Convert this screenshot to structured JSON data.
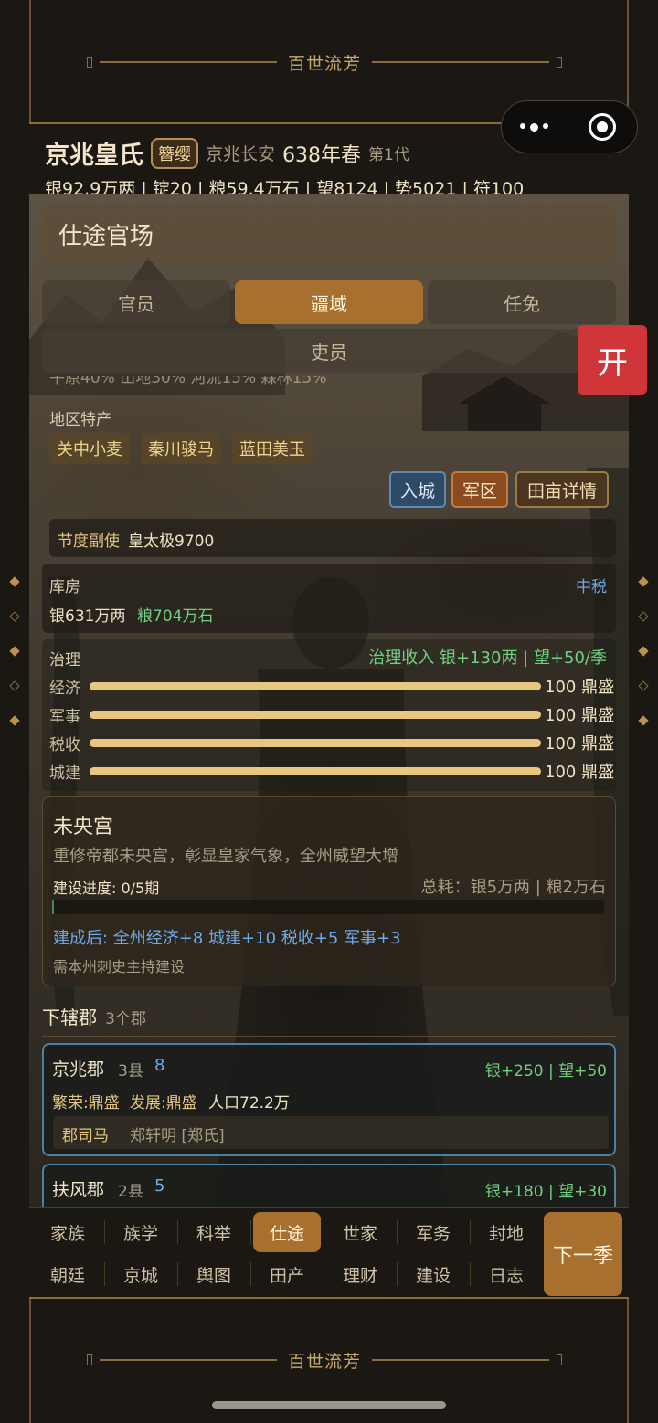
{
  "game_title": "百世流芳",
  "header": {
    "clan_name": "京兆皇氏",
    "title_badge": "簪缨",
    "location": "京兆长安",
    "date": "638年春",
    "generation": "第1代",
    "resources": "银92.9万两 | 锭20 | 粮59.4万石 | 望8124 | 势5021 | 符100"
  },
  "panel": {
    "title": "仕途官场",
    "tabs": [
      {
        "label": "官员",
        "active": false
      },
      {
        "label": "疆域",
        "active": true
      },
      {
        "label": "任免",
        "active": false
      },
      {
        "label": "吏员",
        "active": false
      }
    ]
  },
  "terrain_text": "平原40% 山地30% 河流15% 森林15%",
  "specialties": {
    "label": "地区特产",
    "items": [
      "关中小麦",
      "秦川骏马",
      "蓝田美玉"
    ]
  },
  "actions": [
    "入城",
    "军区",
    "田亩详情"
  ],
  "deputy": {
    "role": "节度副使",
    "name": "皇太极9700"
  },
  "treasury": {
    "label": "库房",
    "tax_level": "中税",
    "silver": "银631万两",
    "grain": "粮704万石"
  },
  "governance": {
    "label": "治理",
    "income": "治理收入 银+130两 | 望+50/季",
    "stats": [
      {
        "name": "经济",
        "value": 100,
        "max": 100,
        "display": "100 鼎盛"
      },
      {
        "name": "军事",
        "value": 100,
        "max": 100,
        "display": "100 鼎盛"
      },
      {
        "name": "税收",
        "value": 100,
        "max": 100,
        "display": "100 鼎盛"
      },
      {
        "name": "城建",
        "value": 100,
        "max": 100,
        "display": "100 鼎盛"
      }
    ]
  },
  "project": {
    "name": "未央宫",
    "desc": "重修帝都未央宫，彰显皇家气象，全州威望大增",
    "progress_label": "建设进度: 0/5期",
    "progress_value": 0,
    "progress_max": 5,
    "cost": "总耗：银5万两 | 粮2万石",
    "effect": "建成后: 全州经济+8 城建+10 税收+5 军事+3",
    "note": "需本州刺史主持建设"
  },
  "commanderies": {
    "label": "下辖郡",
    "count": "3个郡",
    "items": [
      {
        "name": "京兆郡",
        "counties": "3县",
        "level": "8",
        "yield": "银+250 | 望+50",
        "prosperity": "繁荣:鼎盛",
        "development": "发展:鼎盛",
        "population": "人口72.2万",
        "official_role": "郡司马",
        "official_name": "郑轩明 [郑氏]"
      },
      {
        "name": "扶风郡",
        "counties": "2县",
        "level": "5",
        "yield": "银+180 | 望+30"
      }
    ]
  },
  "nav": {
    "row1": [
      {
        "label": "家族",
        "active": false
      },
      {
        "label": "族学",
        "active": false
      },
      {
        "label": "科举",
        "active": false
      },
      {
        "label": "仕途",
        "active": true
      },
      {
        "label": "世家",
        "active": false
      },
      {
        "label": "军务",
        "active": false
      },
      {
        "label": "封地",
        "active": false
      }
    ],
    "row2": [
      {
        "label": "朝廷",
        "active": false
      },
      {
        "label": "京城",
        "active": false
      },
      {
        "label": "舆图",
        "active": false
      },
      {
        "label": "田产",
        "active": false
      },
      {
        "label": "理财",
        "active": false
      },
      {
        "label": "建设",
        "active": false
      },
      {
        "label": "日志",
        "active": false
      }
    ],
    "next_button": "下一季"
  },
  "open_button": "开",
  "colors": {
    "accent": "#a7702e",
    "gold_text": "#e4c47f",
    "green_text": "#6fd17f",
    "blue_text": "#6fa8e6",
    "open_button": "#d0353a"
  }
}
